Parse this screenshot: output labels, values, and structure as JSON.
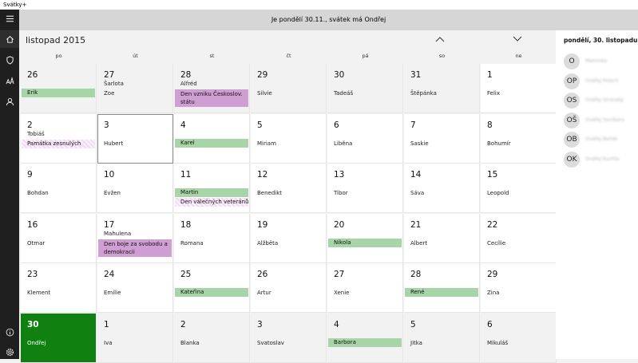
{
  "app": {
    "title": "Svátky+"
  },
  "banner": {
    "text": "Je pondělí 30.11., svátek má Ondřej"
  },
  "calendar": {
    "month_title": "listopad 2015",
    "weekdays": [
      "po",
      "út",
      "st",
      "čt",
      "pá",
      "so",
      "ne"
    ],
    "weeks": [
      [
        {
          "day": "26",
          "name": "",
          "sub": "",
          "out": true,
          "bars": [
            {
              "text": "Erik",
              "style": "green"
            }
          ]
        },
        {
          "day": "27",
          "name": "Zoe",
          "sub": "Šarlota",
          "out": true,
          "bars": []
        },
        {
          "day": "28",
          "name": "",
          "sub": "Alfréd",
          "out": true,
          "bars": [
            {
              "text": "Den vzniku Českoslov. státu",
              "style": "purple",
              "tall": true
            }
          ]
        },
        {
          "day": "29",
          "name": "Silvie",
          "sub": "",
          "out": true,
          "bars": []
        },
        {
          "day": "30",
          "name": "Tadeáš",
          "sub": "",
          "out": true,
          "bars": []
        },
        {
          "day": "31",
          "name": "Štěpánka",
          "sub": "",
          "out": true,
          "bars": []
        },
        {
          "day": "1",
          "name": "Felix",
          "sub": "",
          "out": false,
          "bars": []
        }
      ],
      [
        {
          "day": "2",
          "name": "",
          "sub": "Tobiáš",
          "out": false,
          "bars": [
            {
              "text": "Památka zesnulých",
              "style": "hatch"
            }
          ]
        },
        {
          "day": "3",
          "name": "Hubert",
          "sub": "",
          "out": false,
          "selected": true,
          "bars": []
        },
        {
          "day": "4",
          "name": "",
          "sub": "",
          "out": false,
          "bars": [
            {
              "text": "Karel",
              "style": "green"
            }
          ]
        },
        {
          "day": "5",
          "name": "Miriam",
          "sub": "",
          "out": false,
          "bars": []
        },
        {
          "day": "6",
          "name": "Liběna",
          "sub": "",
          "out": false,
          "bars": []
        },
        {
          "day": "7",
          "name": "Saskie",
          "sub": "",
          "out": false,
          "bars": []
        },
        {
          "day": "8",
          "name": "Bohumír",
          "sub": "",
          "out": false,
          "bars": []
        }
      ],
      [
        {
          "day": "9",
          "name": "Bohdan",
          "sub": "",
          "out": false,
          "bars": []
        },
        {
          "day": "10",
          "name": "Evžen",
          "sub": "",
          "out": false,
          "bars": []
        },
        {
          "day": "11",
          "name": "",
          "sub": "",
          "out": false,
          "bars": [
            {
              "text": "Martin",
              "style": "green"
            },
            {
              "text": "Den válečných veteránů",
              "style": "hatch"
            }
          ]
        },
        {
          "day": "12",
          "name": "Benedikt",
          "sub": "",
          "out": false,
          "bars": []
        },
        {
          "day": "13",
          "name": "Tibor",
          "sub": "",
          "out": false,
          "bars": []
        },
        {
          "day": "14",
          "name": "Sáva",
          "sub": "",
          "out": false,
          "bars": []
        },
        {
          "day": "15",
          "name": "Leopold",
          "sub": "",
          "out": false,
          "bars": []
        }
      ],
      [
        {
          "day": "16",
          "name": "Otmar",
          "sub": "",
          "out": false,
          "bars": []
        },
        {
          "day": "17",
          "name": "",
          "sub": "Mahulena",
          "out": false,
          "bars": [
            {
              "text": "Den boje za svobodu a demokracii",
              "style": "purple",
              "tall": true
            }
          ]
        },
        {
          "day": "18",
          "name": "Romana",
          "sub": "",
          "out": false,
          "bars": []
        },
        {
          "day": "19",
          "name": "Alžběta",
          "sub": "",
          "out": false,
          "bars": []
        },
        {
          "day": "20",
          "name": "",
          "sub": "",
          "out": false,
          "bars": [
            {
              "text": "Nikola",
              "style": "green"
            }
          ]
        },
        {
          "day": "21",
          "name": "Albert",
          "sub": "",
          "out": false,
          "bars": []
        },
        {
          "day": "22",
          "name": "Cecílie",
          "sub": "",
          "out": false,
          "bars": []
        }
      ],
      [
        {
          "day": "23",
          "name": "Klement",
          "sub": "",
          "out": false,
          "bars": []
        },
        {
          "day": "24",
          "name": "Emílie",
          "sub": "",
          "out": false,
          "bars": []
        },
        {
          "day": "25",
          "name": "",
          "sub": "",
          "out": false,
          "bars": [
            {
              "text": "Kateřina",
              "style": "green"
            }
          ]
        },
        {
          "day": "26",
          "name": "Artur",
          "sub": "",
          "out": false,
          "bars": []
        },
        {
          "day": "27",
          "name": "Xenie",
          "sub": "",
          "out": false,
          "bars": []
        },
        {
          "day": "28",
          "name": "",
          "sub": "",
          "out": false,
          "bars": [
            {
              "text": "René",
              "style": "green"
            }
          ]
        },
        {
          "day": "29",
          "name": "Zina",
          "sub": "",
          "out": false,
          "bars": []
        }
      ],
      [
        {
          "day": "30",
          "name": "Ondřej",
          "sub": "",
          "out": false,
          "today": true,
          "bars": []
        },
        {
          "day": "1",
          "name": "Iva",
          "sub": "",
          "out": true,
          "bars": []
        },
        {
          "day": "2",
          "name": "Blanka",
          "sub": "",
          "out": true,
          "bars": []
        },
        {
          "day": "3",
          "name": "Svatoslav",
          "sub": "",
          "out": true,
          "bars": []
        },
        {
          "day": "4",
          "name": "",
          "sub": "",
          "out": true,
          "bars": [
            {
              "text": "Barbora",
              "style": "green"
            }
          ]
        },
        {
          "day": "5",
          "name": "Jitka",
          "sub": "",
          "out": true,
          "bars": []
        },
        {
          "day": "6",
          "name": "Mikuláš",
          "sub": "",
          "out": true,
          "bars": []
        }
      ]
    ]
  },
  "panel": {
    "title": "pondělí, 30. listopadu",
    "contacts": [
      {
        "initials": "O",
        "name": "Maminka"
      },
      {
        "initials": "OP",
        "name": "Ondřej Pelech"
      },
      {
        "initials": "OS",
        "name": "Ondřej Stránský"
      },
      {
        "initials": "OŠ",
        "name": "Ondřej Šembera"
      },
      {
        "initials": "OB",
        "name": "Ondřej Beňák"
      },
      {
        "initials": "OK",
        "name": "Ondřej Kuchta"
      }
    ]
  },
  "sidebar": {
    "icons": [
      "menu-icon",
      "home-icon",
      "shield-icon",
      "text-size-icon",
      "person-icon",
      "info-icon",
      "settings-icon"
    ]
  },
  "colors": {
    "today": "#108010",
    "green_bar": "#a8d5a8",
    "purple_bar": "#cf9fd3"
  }
}
